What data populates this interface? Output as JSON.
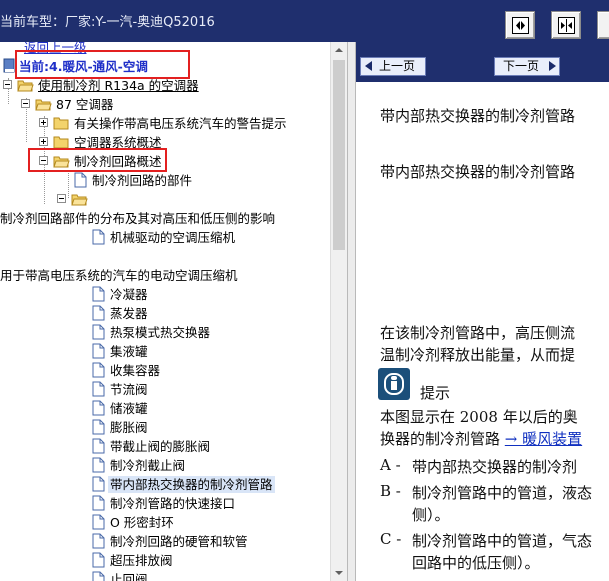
{
  "window": {
    "title": "当前车型：厂家:Y-一汽-奥迪Q52016"
  },
  "colors": {
    "topbar_bg": "#1f2f6e",
    "highlight_box": "#e32020",
    "current_link": "#1f2fc8",
    "selected_bg": "#d9e5f7"
  },
  "toolbar": {
    "buttons": [
      {
        "name": "collapse-pane-icon"
      },
      {
        "name": "expand-pane-icon"
      }
    ]
  },
  "tree": {
    "top_partial": "返回上一级",
    "current": "当前:4.暖风-通风-空调",
    "items": [
      {
        "label": "使用制冷剂 R134a 的空调器"
      },
      {
        "label": "87 空调器"
      },
      {
        "label": "有关操作带高电压系统汽车的警告提示"
      },
      {
        "label": "空调器系统概述"
      },
      {
        "label": "制冷剂回路概述"
      },
      {
        "label": "制冷剂回路的部件"
      },
      {
        "label": ""
      },
      {
        "label": "制冷剂回路部件的分布及其对高压和低压侧的影响"
      },
      {
        "label": "机械驱动的空调压缩机"
      },
      {
        "label": "用于带高电压系统的汽车的电动空调压缩机"
      },
      {
        "label": "冷凝器"
      },
      {
        "label": "蒸发器"
      },
      {
        "label": "热泵模式热交换器"
      },
      {
        "label": "集液罐"
      },
      {
        "label": "收集容器"
      },
      {
        "label": "节流阀"
      },
      {
        "label": "储液罐"
      },
      {
        "label": "膨胀阀"
      },
      {
        "label": "带截止阀的膨胀阀"
      },
      {
        "label": "制冷剂截止阀"
      },
      {
        "label": "带内部热交换器的制冷剂管路"
      },
      {
        "label": "制冷剂管路的快速接口"
      },
      {
        "label": "O 形密封环"
      },
      {
        "label": "制冷剂回路的硬管和软管"
      },
      {
        "label": "超压排放阀"
      },
      {
        "label": "止回阀"
      }
    ]
  },
  "content": {
    "prev_label": "上一页",
    "next_label": "下一页",
    "heading1": "带内部热交换器的制冷剂管路",
    "heading2": "带内部热交换器的制冷剂管路",
    "para1_line1": "在该制冷剂管路中，高压侧流",
    "para1_line2": "温制冷剂释放出能量，从而提",
    "hint_label": "提示",
    "para2_line1": "本图显示在 2008 年以后的奥",
    "para2_line2_text": "换器的制冷剂管路",
    "para2_link": "→ 暖风装置",
    "list": [
      {
        "letter": "A -",
        "lines": [
          "带内部热交换器的制冷剂"
        ]
      },
      {
        "letter": "B -",
        "lines": [
          "制冷剂管路中的管道，液态",
          "侧）。"
        ]
      },
      {
        "letter": "C -",
        "lines": [
          "制冷剂管路中的管道，气态",
          "回路中的低压侧）。"
        ]
      }
    ]
  }
}
